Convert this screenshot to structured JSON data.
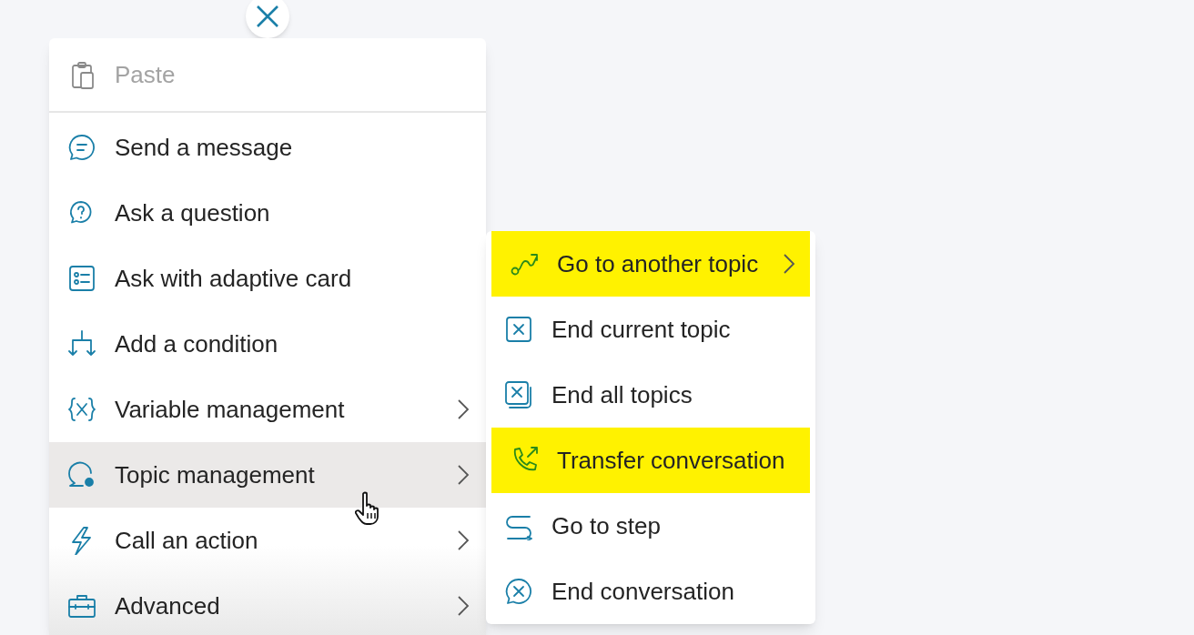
{
  "menu": {
    "items": [
      {
        "label": "Paste",
        "disabled": true,
        "submenu": false,
        "selected": false
      },
      {
        "label": "Send a message",
        "disabled": false,
        "submenu": false,
        "selected": false
      },
      {
        "label": "Ask a question",
        "disabled": false,
        "submenu": false,
        "selected": false
      },
      {
        "label": "Ask with adaptive card",
        "disabled": false,
        "submenu": false,
        "selected": false
      },
      {
        "label": "Add a condition",
        "disabled": false,
        "submenu": false,
        "selected": false
      },
      {
        "label": "Variable management",
        "disabled": false,
        "submenu": true,
        "selected": false
      },
      {
        "label": "Topic management",
        "disabled": false,
        "submenu": true,
        "selected": true
      },
      {
        "label": "Call an action",
        "disabled": false,
        "submenu": true,
        "selected": false
      },
      {
        "label": "Advanced",
        "disabled": false,
        "submenu": true,
        "selected": false
      }
    ]
  },
  "submenu": {
    "items": [
      {
        "label": "Go to another topic",
        "submenu": true,
        "highlighted": true
      },
      {
        "label": "End current topic",
        "submenu": false,
        "highlighted": false
      },
      {
        "label": "End all topics",
        "submenu": false,
        "highlighted": false
      },
      {
        "label": "Transfer conversation",
        "submenu": false,
        "highlighted": true
      },
      {
        "label": "Go to step",
        "submenu": false,
        "highlighted": false
      },
      {
        "label": "End conversation",
        "submenu": false,
        "highlighted": false
      }
    ]
  }
}
